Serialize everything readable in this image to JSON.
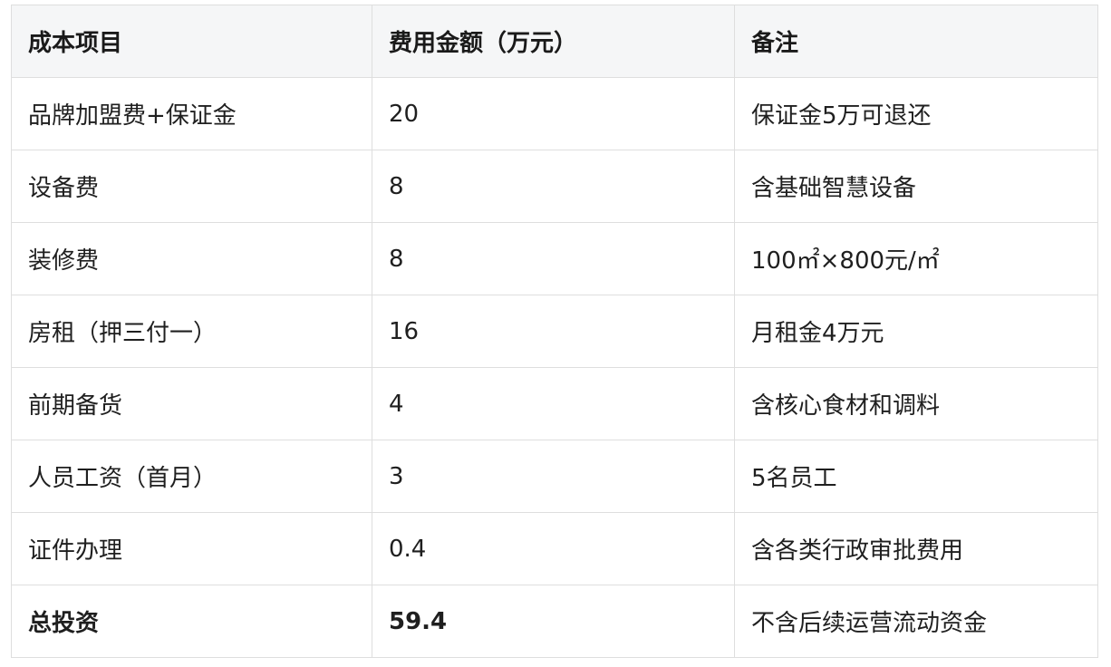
{
  "table": {
    "headers": [
      "成本项目",
      "费用金额（万元）",
      "备注"
    ],
    "rows": [
      {
        "item": "品牌加盟费+保证金",
        "amount": "20",
        "note": "保证金5万可退还"
      },
      {
        "item": "设备费",
        "amount": "8",
        "note": "含基础智慧设备"
      },
      {
        "item": "装修费",
        "amount": "8",
        "note": "100㎡×800元/㎡"
      },
      {
        "item": "房租（押三付一）",
        "amount": "16",
        "note": "月租金4万元"
      },
      {
        "item": "前期备货",
        "amount": "4",
        "note": "含核心食材和调料"
      },
      {
        "item": "人员工资（首月）",
        "amount": "3",
        "note": "5名员工"
      },
      {
        "item": "证件办理",
        "amount": "0.4",
        "note": "含各类行政审批费用"
      }
    ],
    "total": {
      "item": "总投资",
      "amount": "59.4",
      "note": "不含后续运营流动资金"
    }
  }
}
